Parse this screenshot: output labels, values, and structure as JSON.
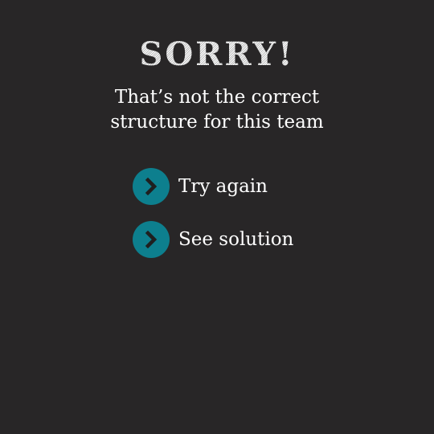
{
  "dialog": {
    "title": "SORRY!",
    "message_line1": "That’s not the correct",
    "message_line2": "structure for this team"
  },
  "options": [
    {
      "label": "Try again",
      "icon": "chevron-right-icon"
    },
    {
      "label": "See solution",
      "icon": "chevron-right-icon"
    }
  ],
  "colors": {
    "background": "#282627",
    "accent": "#0d7f8e",
    "text": "#ffffff",
    "chevron": "#1f1f1f"
  }
}
